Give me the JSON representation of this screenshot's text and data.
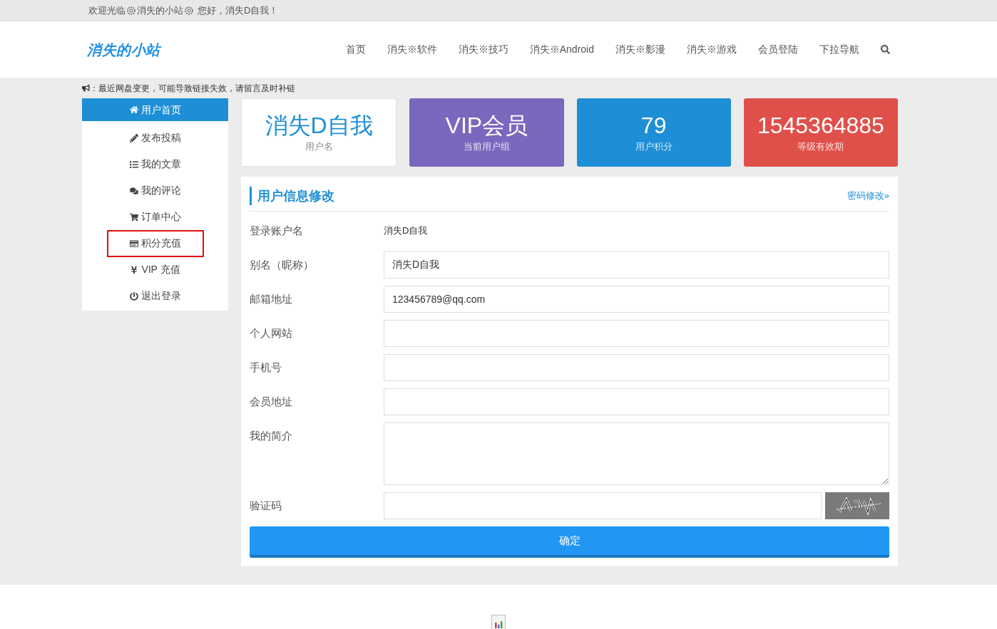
{
  "top_bar": {
    "welcome": "欢迎光临",
    "site": "消失的小站",
    "greeting": "您好，消失D自我！"
  },
  "header": {
    "logo": "消失的小站",
    "nav": [
      {
        "label": "首页"
      },
      {
        "label": "消失※软件"
      },
      {
        "label": "消失※技巧"
      },
      {
        "label": "消失※Android"
      },
      {
        "label": "消失※影漫"
      },
      {
        "label": "消失※游戏"
      },
      {
        "label": "会员登陆"
      },
      {
        "label": "下拉导航"
      }
    ]
  },
  "notice": "：最近网盘变更，可能导致链接失效，请留言及时补链",
  "sidebar": {
    "items": [
      {
        "label": "用户首页",
        "selected": true,
        "highlighted": false
      },
      {
        "label": "发布投稿",
        "selected": false,
        "highlighted": false
      },
      {
        "label": "我的文章",
        "selected": false,
        "highlighted": false
      },
      {
        "label": "我的评论",
        "selected": false,
        "highlighted": false
      },
      {
        "label": "订单中心",
        "selected": false,
        "highlighted": false
      },
      {
        "label": "积分充值",
        "selected": false,
        "highlighted": true
      },
      {
        "label": "VIP 充值",
        "selected": false,
        "highlighted": false
      },
      {
        "label": "退出登录",
        "selected": false,
        "highlighted": false
      }
    ]
  },
  "stats": [
    {
      "value": "消失D自我",
      "label": "用户名",
      "color": "#ffffff"
    },
    {
      "value": "VIP会员",
      "label": "当前用户组",
      "color": "#7a68be"
    },
    {
      "value": "79",
      "label": "用户积分",
      "color": "#1e8fd6"
    },
    {
      "value": "1545364885",
      "label": "等级有效期",
      "color": "#e0504a"
    }
  ],
  "form": {
    "title": "用户信息修改",
    "link": "密码修改»",
    "fields": [
      {
        "label": "登录账户名",
        "kind": "static",
        "value": "消失D自我"
      },
      {
        "label": "别名（昵称）",
        "kind": "input",
        "value": "消失D自我"
      },
      {
        "label": "邮箱地址",
        "kind": "input",
        "value": "123456789@qq.com"
      },
      {
        "label": "个人网站",
        "kind": "input"
      },
      {
        "label": "手机号",
        "kind": "input"
      },
      {
        "label": "会员地址",
        "kind": "input"
      },
      {
        "label": "我的简介",
        "kind": "textarea"
      },
      {
        "label": "验证码",
        "kind": "captcha"
      }
    ],
    "submit": "确定"
  }
}
